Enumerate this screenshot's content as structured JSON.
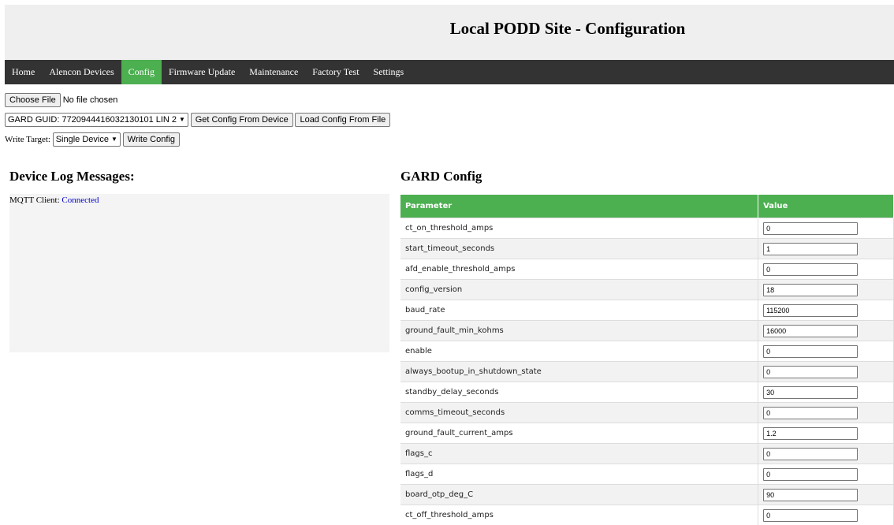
{
  "header": {
    "title": "Local PODD Site - Configuration"
  },
  "nav": {
    "items": [
      {
        "label": "Home",
        "active": false
      },
      {
        "label": "Alencon Devices",
        "active": false
      },
      {
        "label": "Config",
        "active": true
      },
      {
        "label": "Firmware Update",
        "active": false
      },
      {
        "label": "Maintenance",
        "active": false
      },
      {
        "label": "Factory Test",
        "active": false
      },
      {
        "label": "Settings",
        "active": false
      }
    ],
    "active_color": "#4caf50",
    "background_color": "#333333"
  },
  "file_picker": {
    "button_label": "Choose File",
    "status": "No file chosen"
  },
  "device_select": {
    "selected": "GARD GUID: 7720944416032130101 LIN 2"
  },
  "buttons": {
    "get_config": "Get Config From Device",
    "load_config": "Load Config From File",
    "write_config": "Write Config"
  },
  "write_target": {
    "label": "Write Target:",
    "selected": "Single Device"
  },
  "log": {
    "title": "Device Log Messages:",
    "mqtt_label": "MQTT Client:",
    "mqtt_status": "Connected"
  },
  "config": {
    "title": "GARD Config",
    "columns": [
      "Parameter",
      "Value"
    ],
    "rows": [
      {
        "param": "ct_on_threshold_amps",
        "value": "0"
      },
      {
        "param": "start_timeout_seconds",
        "value": "1"
      },
      {
        "param": "afd_enable_threshold_amps",
        "value": "0"
      },
      {
        "param": "config_version",
        "value": "18"
      },
      {
        "param": "baud_rate",
        "value": "115200"
      },
      {
        "param": "ground_fault_min_kohms",
        "value": "16000"
      },
      {
        "param": "enable",
        "value": "0"
      },
      {
        "param": "always_bootup_in_shutdown_state",
        "value": "0"
      },
      {
        "param": "standby_delay_seconds",
        "value": "30"
      },
      {
        "param": "comms_timeout_seconds",
        "value": "0"
      },
      {
        "param": "ground_fault_current_amps",
        "value": "1.2"
      },
      {
        "param": "flags_c",
        "value": "0"
      },
      {
        "param": "flags_d",
        "value": "0"
      },
      {
        "param": "board_otp_deg_C",
        "value": "90"
      },
      {
        "param": "ct_off_threshold_amps",
        "value": "0"
      }
    ]
  }
}
